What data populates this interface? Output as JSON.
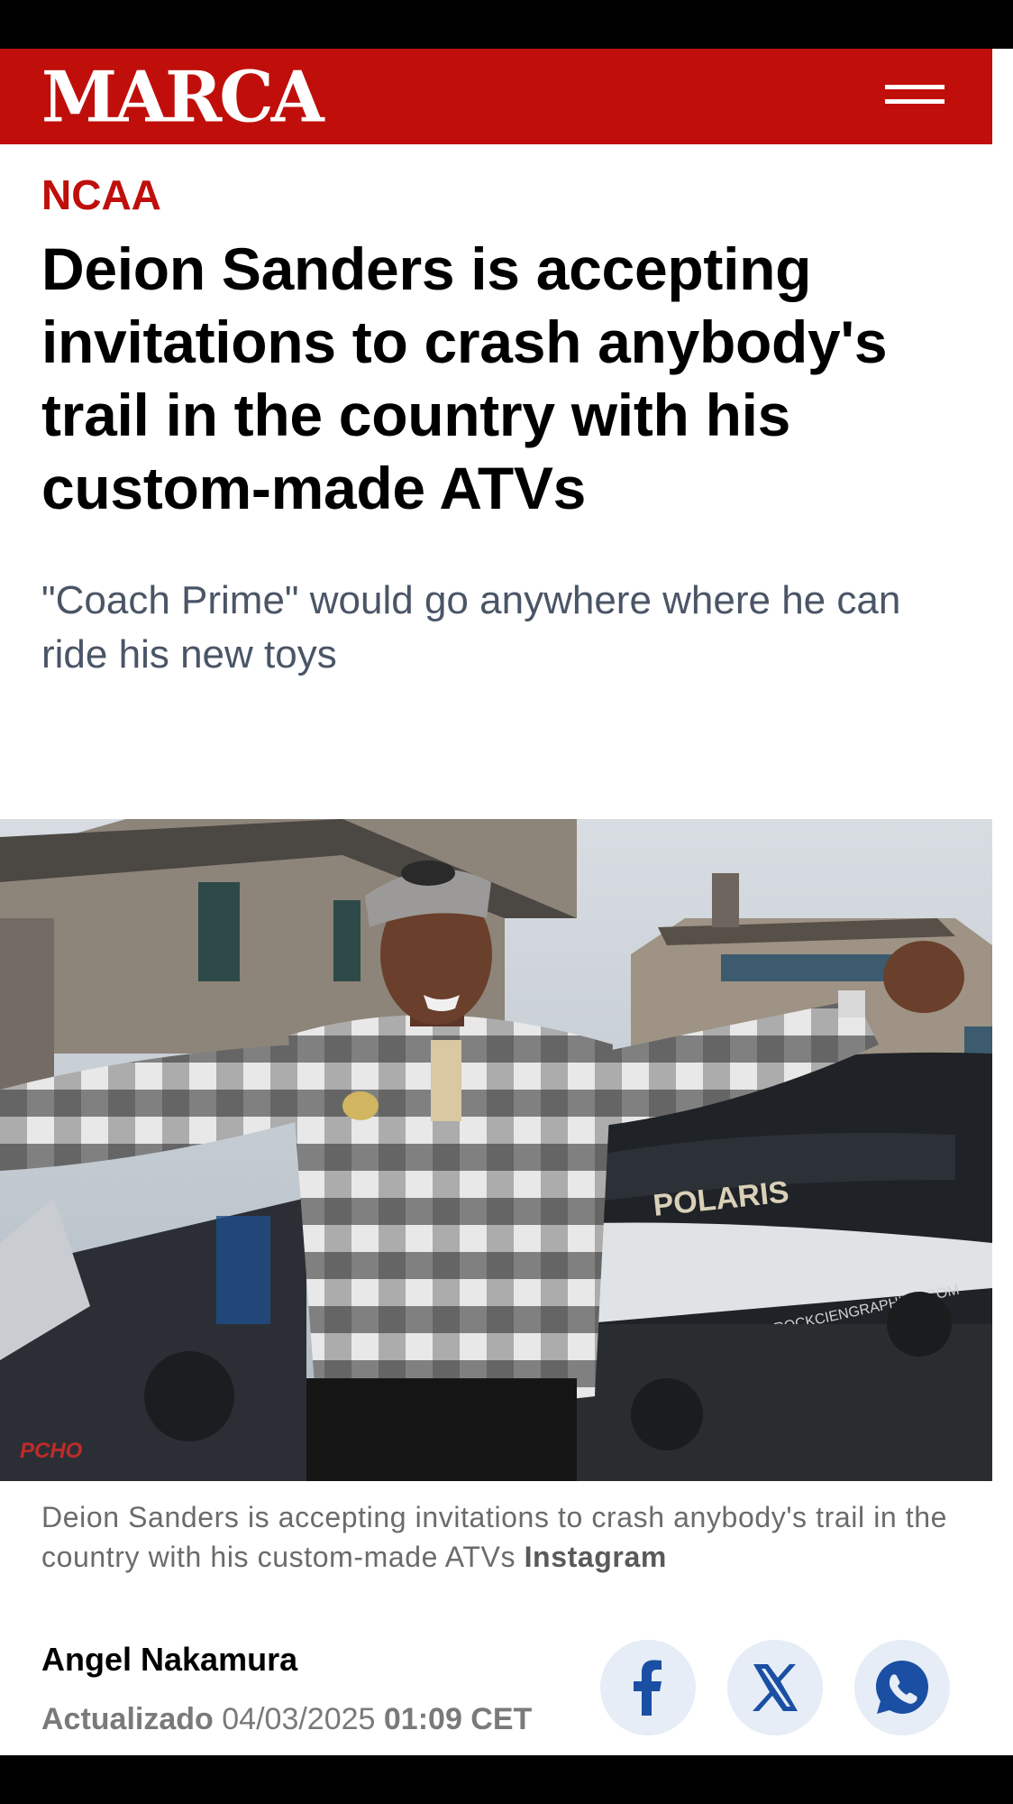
{
  "header": {
    "logo": "MARCA",
    "menu_icon": "hamburger-menu-icon",
    "brand_color": "#c00f0b"
  },
  "article": {
    "section": "NCAA",
    "headline": "Deion Sanders is accepting invitations to crash anybody's trail in the country with his custom-made ATVs",
    "subheadline": "\"Coach Prime\" would go anywhere where he can ride his new toys",
    "caption_text": "Deion Sanders is accepting invitations to crash anybody's trail in the country with his custom-made ATVs",
    "caption_credit": "Instagram",
    "photo_text": {
      "brand": "POLARIS",
      "website": "ROCKCIENGRAPHICS.COM",
      "watermark": "PCHO"
    }
  },
  "byline": {
    "author": "Angel Nakamura",
    "updated_label": "Actualizado",
    "date": "04/03/2025",
    "time": "01:09 CET"
  },
  "share": {
    "facebook_icon": "facebook-icon",
    "x_icon": "x-icon",
    "whatsapp_icon": "whatsapp-icon",
    "icon_color": "#1a4fa3",
    "button_bg": "#e6edf6"
  }
}
